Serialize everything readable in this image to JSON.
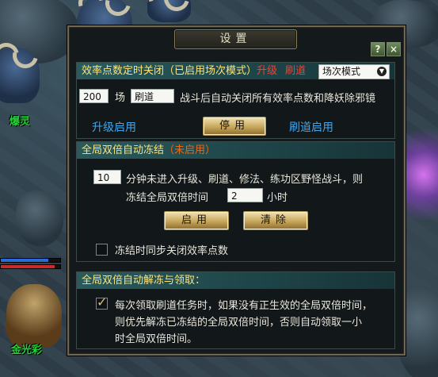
{
  "scene": {
    "npc_top_name": "爆灵",
    "npc_bottom_name": "金光彩"
  },
  "dialog": {
    "title": "设置",
    "help_label": "?",
    "close_label": "×"
  },
  "section1": {
    "head_text": "效率点数定时关闭（已启用场次模式）",
    "head_level": "升级",
    "head_brush": "刷道",
    "mode_selected": "场次模式",
    "count_value": "200",
    "unit_label": "场",
    "mode_value": "刷道",
    "description": "战斗后自动关闭所有效率点数和降妖除邪镜",
    "level_enable": "升级启用",
    "stop_button": "停用",
    "brush_enable": "刷道启用"
  },
  "section2": {
    "head_text": "全局双倍自动冻结",
    "head_status": "（未启用）",
    "minutes_value": "10",
    "line1": "分钟未进入升级、刷道、修法、练功区野怪战斗，则",
    "line2_prefix": "冻结全局双倍时间",
    "hours_value": "2",
    "hours_unit": "小时",
    "enable_button": "启用",
    "clear_button": "清除",
    "sync_close_label": "冻结时同步关闭效率点数"
  },
  "section3": {
    "head_text": "全局双倍自动解冻与领取：",
    "line1": "每次领取刷道任务时，如果没有正生效的全局双倍时间，",
    "line2": "则优先解冻已冻结的全局双倍时间，否则自动领取一小",
    "line3": "时全局双倍时间。"
  }
}
